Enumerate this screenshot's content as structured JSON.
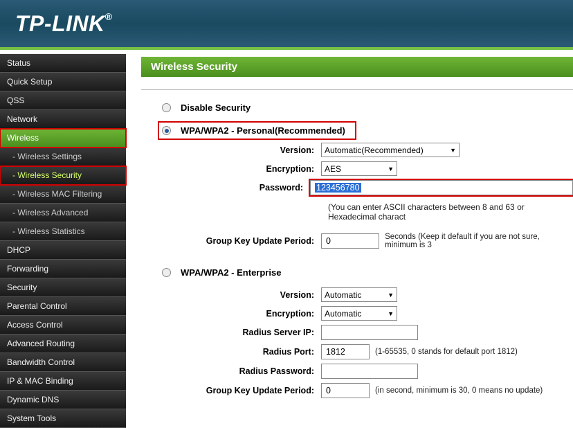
{
  "brand": "TP-LINK",
  "sidebar": {
    "items": [
      {
        "label": "Status",
        "sub": false
      },
      {
        "label": "Quick Setup",
        "sub": false
      },
      {
        "label": "QSS",
        "sub": false
      },
      {
        "label": "Network",
        "sub": false
      },
      {
        "label": "Wireless",
        "sub": false,
        "activeParent": true,
        "red": true
      },
      {
        "label": "- Wireless Settings",
        "sub": true
      },
      {
        "label": "- Wireless Security",
        "sub": true,
        "activeSub": true,
        "red": true
      },
      {
        "label": "- Wireless MAC Filtering",
        "sub": true
      },
      {
        "label": "- Wireless Advanced",
        "sub": true
      },
      {
        "label": "- Wireless Statistics",
        "sub": true
      },
      {
        "label": "DHCP",
        "sub": false
      },
      {
        "label": "Forwarding",
        "sub": false
      },
      {
        "label": "Security",
        "sub": false
      },
      {
        "label": "Parental Control",
        "sub": false
      },
      {
        "label": "Access Control",
        "sub": false
      },
      {
        "label": "Advanced Routing",
        "sub": false
      },
      {
        "label": "Bandwidth Control",
        "sub": false
      },
      {
        "label": "IP & MAC Binding",
        "sub": false
      },
      {
        "label": "Dynamic DNS",
        "sub": false
      },
      {
        "label": "System Tools",
        "sub": false
      }
    ]
  },
  "page": {
    "title": "Wireless Security",
    "disable_label": "Disable Security",
    "wpa_personal_label": "WPA/WPA2 - Personal(Recommended)",
    "personal": {
      "version_label": "Version:",
      "version_value": "Automatic(Recommended)",
      "encryption_label": "Encryption:",
      "encryption_value": "AES",
      "password_label": "Password:",
      "password_value": "123456780",
      "password_note": "(You can enter ASCII characters between 8 and 63 or Hexadecimal charact",
      "gkup_label": "Group Key Update Period:",
      "gkup_value": "0",
      "gkup_note": "Seconds (Keep it default if you are not sure, minimum is 3"
    },
    "wpa_enterprise_label": "WPA/WPA2 - Enterprise",
    "enterprise": {
      "version_label": "Version:",
      "version_value": "Automatic",
      "encryption_label": "Encryption:",
      "encryption_value": "Automatic",
      "radius_ip_label": "Radius Server IP:",
      "radius_ip_value": "",
      "radius_port_label": "Radius Port:",
      "radius_port_value": "1812",
      "radius_port_note": "(1-65535, 0 stands for default port 1812)",
      "radius_pw_label": "Radius Password:",
      "radius_pw_value": "",
      "gkup_label": "Group Key Update Period:",
      "gkup_value": "0",
      "gkup_note": "(in second, minimum is 30, 0 means no update)"
    }
  }
}
